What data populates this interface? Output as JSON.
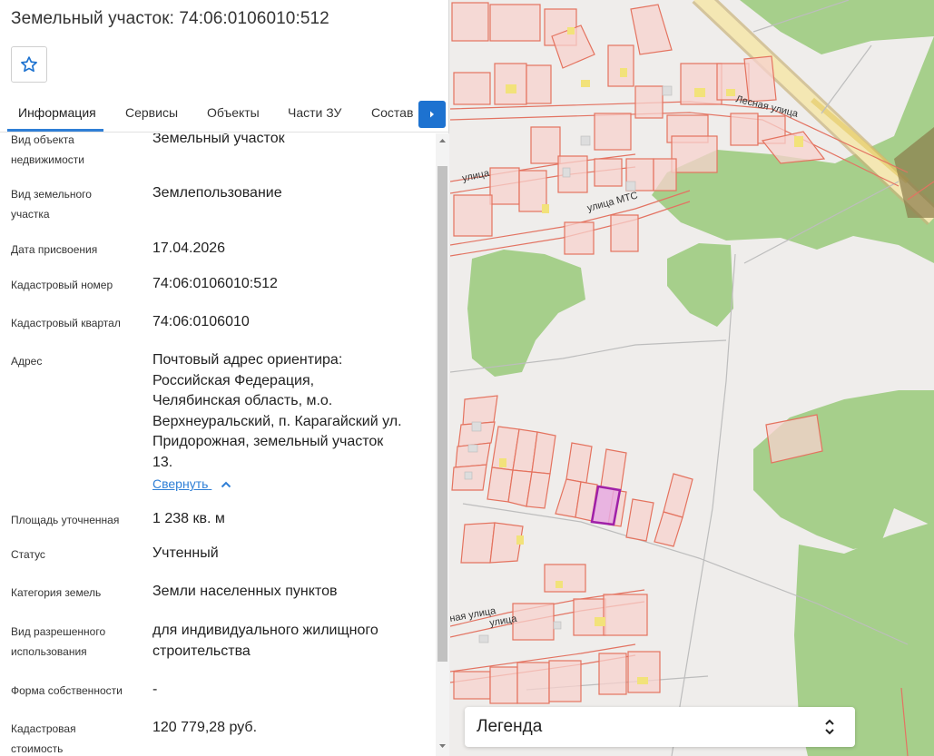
{
  "header": {
    "title": "Земельный участок: 74:06:0106010:512"
  },
  "tabs": [
    {
      "label": "Информация",
      "active": true
    },
    {
      "label": "Сервисы"
    },
    {
      "label": "Объекты"
    },
    {
      "label": "Части ЗУ"
    },
    {
      "label": "Состав"
    }
  ],
  "info": {
    "object_type": {
      "label_l1": "Вид объекта",
      "label_l2": "недвижимости",
      "value": "Земельный участок"
    },
    "parcel_type": {
      "label_l1": "Вид земельного",
      "label_l2": "участка",
      "value": "Землепользование"
    },
    "date": {
      "label": "Дата присвоения",
      "value": "17.04.2026"
    },
    "cad_number": {
      "label": "Кадастровый номер",
      "value": "74:06:0106010:512"
    },
    "cad_quarter": {
      "label": "Кадастровый квартал",
      "value": "74:06:0106010"
    },
    "address": {
      "label": "Адрес",
      "lines": [
        "Почтовый адрес ориентира:",
        "Российская Федерация,",
        "Челябинская область, м.о.",
        "Верхнеуральский, п. Карагайский ул.",
        "Придорожная, земельный участок",
        "13."
      ],
      "collapse_label": "Свернуть"
    },
    "area": {
      "label": "Площадь уточненная",
      "value": "1 238 кв. м"
    },
    "status": {
      "label": "Статус",
      "value": "Учтенный"
    },
    "category": {
      "label": "Категория земель",
      "value": "Земли населенных пунктов"
    },
    "permitted_use": {
      "label_l1": "Вид разрешенного",
      "label_l2": "использования",
      "value_l1": "для индивидуального жилищного",
      "value_l2": "строительства"
    },
    "ownership": {
      "label": "Форма собственности",
      "value": "-"
    },
    "cad_value": {
      "label_l1": "Кадастровая",
      "label_l2": "стоимость",
      "value": "120 779,28 руб."
    }
  },
  "map": {
    "street_labels": [
      "Лесная улица",
      "улица МТС",
      "улица",
      "улица",
      "ная улица"
    ],
    "legend_label": "Легенда"
  },
  "icons": [
    "star-icon",
    "chevron-right-icon",
    "chevron-up-icon",
    "expand-icon"
  ],
  "colors": {
    "accent": "#1d72d0",
    "link": "#2f7fd6",
    "parcel_stroke": "#e4735f",
    "parcel_fill": "#f8d3d0",
    "selected_parcel": "#a020a8",
    "forest": "#a4d08a",
    "road": "#f7e4a8"
  }
}
